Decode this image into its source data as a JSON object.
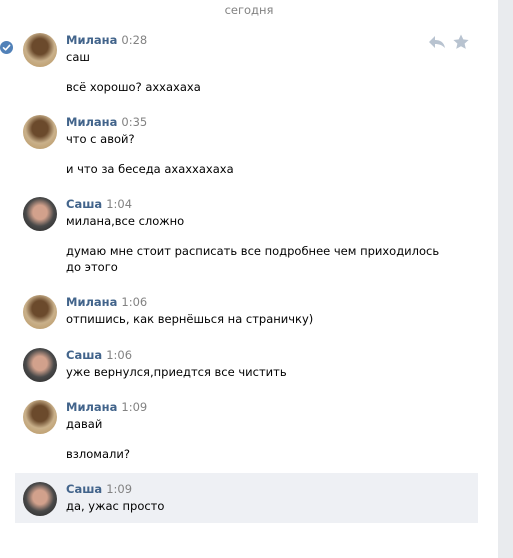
{
  "date_separator": "сегодня",
  "messages": [
    {
      "author": "Милана",
      "time": "0:28",
      "avatar": "milana",
      "lines": [
        "саш",
        "всё хорошо? аххахаха"
      ]
    },
    {
      "author": "Милана",
      "time": "0:35",
      "avatar": "milana",
      "lines": [
        "что с авой?",
        "и что за беседа ахаххахаха"
      ]
    },
    {
      "author": "Саша",
      "time": "1:04",
      "avatar": "sasha",
      "lines": [
        "милана,все сложно",
        "думаю мне стоит расписать все подробнее чем приходилось",
        "до этого"
      ]
    },
    {
      "author": "Милана",
      "time": "1:06",
      "avatar": "milana",
      "lines": [
        "отпишись, как вернёшься на страничку)"
      ]
    },
    {
      "author": "Саша",
      "time": "1:06",
      "avatar": "sasha",
      "lines": [
        "уже вернулся,приедтся все чистить"
      ]
    },
    {
      "author": "Милана",
      "time": "1:09",
      "avatar": "milana",
      "lines": [
        "давай",
        "взломали?"
      ]
    },
    {
      "author": "Саша",
      "time": "1:09",
      "avatar": "sasha",
      "lines": [
        "да, ужас просто"
      ]
    }
  ],
  "icons": {
    "selected": "check-circle-icon",
    "reply": "reply-icon",
    "favorite": "star-icon"
  },
  "colors": {
    "author": "#42648b",
    "time": "#828282",
    "accent": "#5181b8",
    "highlight": "#eef0f4",
    "icon": "#b8c3d0"
  }
}
